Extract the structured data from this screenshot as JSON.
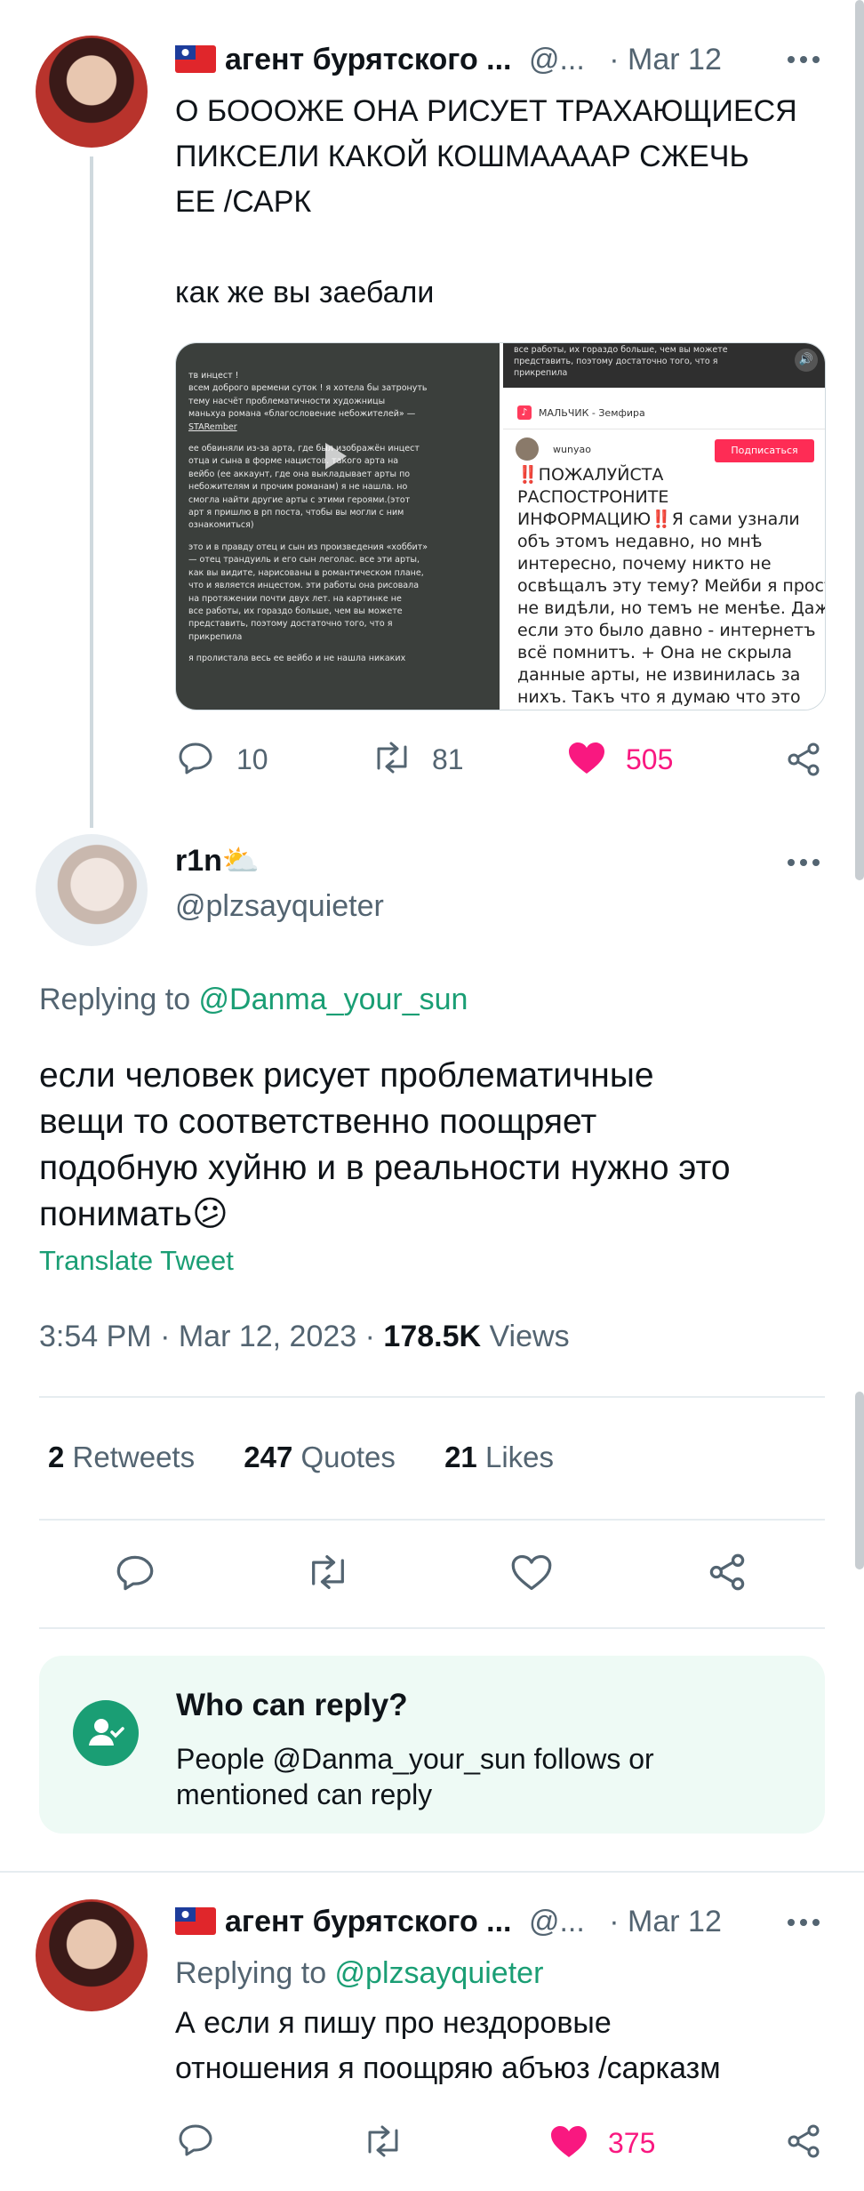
{
  "colors": {
    "accent": "#1a9e74",
    "like": "#f91880",
    "muted": "#536471",
    "banner_bg": "#eefaf5"
  },
  "tweet1": {
    "author_name": "агент бурятского ...",
    "handle": "@...",
    "date": "· Mar 12",
    "text_line1": "О БОООЖЕ ОНА РИСУЕТ ТРАХАЮЩИЕСЯ",
    "text_line2": "ПИКСЕЛИ КАКОЙ КОШМААААР СЖЕЧЬ",
    "text_line3": "ЕЕ /САРК",
    "text_line4": "как же вы заебали",
    "media_left": {
      "line1": "тв инцест !",
      "line2": "всем доброго времени суток ! я хотела бы затронуть",
      "line3": "тему насчёт проблематичности художницы",
      "line4": "маньхуа романа «благословение небожителей» —",
      "line5": "STARember",
      "line6": "ее обвиняли из-за арта, где был изображён инцест",
      "line7": "отца и сына в форме нацистов. такого арта на",
      "line8": "вейбо (ее аккаунт, где она выкладывает арты по",
      "line9": "небожителям и прочим романам) я не нашла. но",
      "line10": "смогла найти другие арты с этими героями.(этот",
      "line11": "арт я пришлю в рп поста, чтобы вы могли с ним",
      "line12": "ознакомиться)",
      "line13": "это и в правду отец и сын из произведения «хоббит»",
      "line14": "— отец трандуиль и его сын леголас. все эти арты,",
      "line15": "как вы видите, нарисованы в романтическом плане,",
      "line16": "что и является инцестом. эти работы она рисовала",
      "line17": "на протяжении почти двух лет. на картинке не",
      "line18": "все работы, их гораздо больше, чем вы можете",
      "line19": "представить, поэтому достаточно того, что я",
      "line20": "прикрепила",
      "line21": "я пролистала весь ее вейбо и не нашла никаких"
    },
    "media_right": {
      "top1": "все работы, их гораздо больше, чем вы можете",
      "top2": "представить, поэтому достаточно того, что я",
      "top3": "прикрепила",
      "song": "МАЛЬЧИК - Земфира",
      "user": "wunyao",
      "follow": "Подписаться",
      "body1": "‼️ПОЖАЛУЙСТА",
      "body2": "РАСПОСТРОНИТЕ",
      "body3": "ИНФОРМАЦИЮ‼️Я сами узнали",
      "body4": "объ этомъ недавно, но мнѣ",
      "body5": "интересно, почему никто не",
      "body6": "освѣщалъ эту тему? Мейби я просто",
      "body7": "не видѣли, но темъ не менѣе. Даже",
      "body8": "если это было давно - интернетъ",
      "body9": "всё помнитъ. + Она не скрыла",
      "body10": "данные арты, не извинилась за",
      "body11": "нихъ. Такъ что я думаю что это"
    },
    "replies": "10",
    "retweets": "81",
    "likes": "505"
  },
  "tweet2": {
    "author_name": "r1n⛅",
    "handle": "@plzsayquieter",
    "replying_prefix": "Replying to ",
    "replying_to": "@Danma_your_sun",
    "text_line1": "если человек рисует проблематичные",
    "text_line2": "вещи то соответственно поощряет",
    "text_line3": "подобную хуйню и в реальности нужно это",
    "text_line4": "понимать😕",
    "translate": "Translate Tweet",
    "time": "3:54 PM · Mar 12, 2023 · ",
    "views_count": "178.5K",
    "views_label": " Views",
    "retweets_count": "2",
    "retweets_label": " Retweets",
    "quotes_count": "247",
    "quotes_label": " Quotes",
    "likes_count": "21",
    "likes_label": " Likes"
  },
  "banner": {
    "title": "Who can reply?",
    "line1": "People @Danma_your_sun follows or",
    "line2": "mentioned can reply"
  },
  "tweet3": {
    "author_name": "агент бурятского ...",
    "handle": "@...",
    "date": "· Mar 12",
    "replying_prefix": "Replying to ",
    "replying_to": "@plzsayquieter",
    "text_line1": "А если я пишу про нездоровые",
    "text_line2": "отношения я поощряю абъюз /сарказм",
    "likes": "375"
  }
}
